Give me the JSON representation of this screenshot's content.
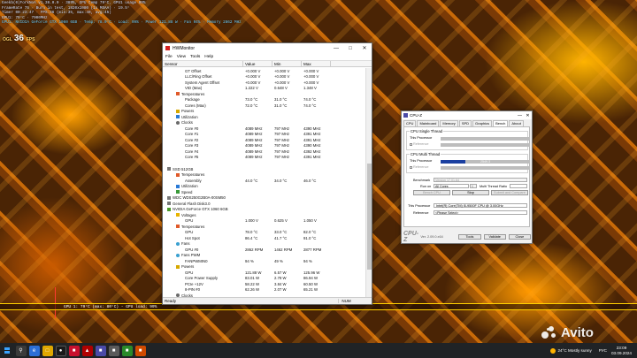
{
  "osd": {
    "lines": [
      "Geekb(0)ForkNoA v1.36.0.0 · 389%, GPU temp 79°C, GPU1 usage 99%",
      "FrameRate 75 · Burn in test, 1920x1080 (1x MSAA) · 19.5°",
      "Timer 00:23:47 · FPS:36 (min:35, max:40, avg:45)",
      "GPU1: 79°C · 7900MHz",
      "GPU1: NVIDIA GeForce GTX 1060 6GB · Temp: 78.0°C · Load: 99% · Power 121.88 W · Fan 94% · Memory 2862 MHz"
    ],
    "fps_label": "OGL",
    "fps_value": "36",
    "fps_unit": "FPS"
  },
  "bottom_overlay": "GPU 1: 79°C (max: 80°C) - GPU load: 99%",
  "hwmonitor": {
    "title": "HWMonitor",
    "menu": [
      "File",
      "View",
      "Tools",
      "Help"
    ],
    "columns": [
      "Sensor",
      "Value",
      "Min",
      "Max"
    ],
    "status_left": "Ready",
    "status_num": "NUM",
    "rows": [
      {
        "indent": 5,
        "icon": "none",
        "name": "GT Offset",
        "value": "+0.000 V",
        "min": "+0.000 V",
        "max": "+0.000 V"
      },
      {
        "indent": 5,
        "icon": "none",
        "name": "LLC/Ring Offset",
        "value": "+0.000 V",
        "min": "+0.000 V",
        "max": "+0.000 V"
      },
      {
        "indent": 5,
        "icon": "none",
        "name": "System Agent Offset",
        "value": "+0.000 V",
        "min": "+0.000 V",
        "max": "+0.000 V"
      },
      {
        "indent": 5,
        "icon": "none",
        "name": "VID (Max)",
        "value": "1.222 V",
        "min": "0.648 V",
        "max": "1.348 V"
      },
      {
        "indent": 3,
        "icon": "temp",
        "name": "Temperatures",
        "value": "",
        "min": "",
        "max": ""
      },
      {
        "indent": 5,
        "icon": "none",
        "name": "Package",
        "value": "73.0 °C",
        "min": "31.0 °C",
        "max": "74.0 °C"
      },
      {
        "indent": 5,
        "icon": "none",
        "name": "Cores (Max)",
        "value": "72.0 °C",
        "min": "31.0 °C",
        "max": "74.0 °C"
      },
      {
        "indent": 3,
        "icon": "power",
        "name": "Powers",
        "value": "",
        "min": "",
        "max": ""
      },
      {
        "indent": 3,
        "icon": "util",
        "name": "Utilization",
        "value": "",
        "min": "",
        "max": ""
      },
      {
        "indent": 3,
        "icon": "clock",
        "name": "Clocks",
        "value": "",
        "min": "",
        "max": ""
      },
      {
        "indent": 5,
        "icon": "none",
        "name": "Core #0",
        "value": "4089 MHz",
        "min": "797 MHz",
        "max": "4390 MHz"
      },
      {
        "indent": 5,
        "icon": "none",
        "name": "Core #1",
        "value": "4089 MHz",
        "min": "797 MHz",
        "max": "4391 MHz"
      },
      {
        "indent": 5,
        "icon": "none",
        "name": "Core #2",
        "value": "4089 MHz",
        "min": "797 MHz",
        "max": "4391 MHz"
      },
      {
        "indent": 5,
        "icon": "none",
        "name": "Core #3",
        "value": "4089 MHz",
        "min": "797 MHz",
        "max": "4390 MHz"
      },
      {
        "indent": 5,
        "icon": "none",
        "name": "Core #4",
        "value": "4089 MHz",
        "min": "797 MHz",
        "max": "4392 MHz"
      },
      {
        "indent": 5,
        "icon": "none",
        "name": "Core #5",
        "value": "4089 MHz",
        "min": "797 MHz",
        "max": "4391 MHz"
      },
      {
        "indent": 0,
        "icon": "none",
        "name": "",
        "value": "",
        "min": "",
        "max": ""
      },
      {
        "indent": 1,
        "icon": "disk",
        "name": "SSD 512GB",
        "value": "",
        "min": "",
        "max": ""
      },
      {
        "indent": 3,
        "icon": "temp",
        "name": "Temperatures",
        "value": "",
        "min": "",
        "max": ""
      },
      {
        "indent": 5,
        "icon": "none",
        "name": "Assembly",
        "value": "44.0 °C",
        "min": "34.0 °C",
        "max": "46.0 °C"
      },
      {
        "indent": 3,
        "icon": "util",
        "name": "Utilization",
        "value": "",
        "min": "",
        "max": ""
      },
      {
        "indent": 3,
        "icon": "speed",
        "name": "Speed",
        "value": "",
        "min": "",
        "max": ""
      },
      {
        "indent": 1,
        "icon": "disk",
        "name": "WDC WDS250G2B0A-00SM50",
        "value": "",
        "min": "",
        "max": ""
      },
      {
        "indent": 1,
        "icon": "disk",
        "name": "General Flash Disk3.0",
        "value": "",
        "min": "",
        "max": ""
      },
      {
        "indent": 1,
        "icon": "gpu",
        "name": "NVIDIA GeForce GTX 1060 6GB",
        "value": "",
        "min": "",
        "max": ""
      },
      {
        "indent": 3,
        "icon": "volt",
        "name": "Voltages",
        "value": "",
        "min": "",
        "max": ""
      },
      {
        "indent": 5,
        "icon": "none",
        "name": "GPU",
        "value": "1.000 V",
        "min": "0.625 V",
        "max": "1.050 V"
      },
      {
        "indent": 3,
        "icon": "temp",
        "name": "Temperatures",
        "value": "",
        "min": "",
        "max": ""
      },
      {
        "indent": 5,
        "icon": "none",
        "name": "GPU",
        "value": "78.0 °C",
        "min": "33.0 °C",
        "max": "82.0 °C"
      },
      {
        "indent": 5,
        "icon": "none",
        "name": "Hot Spot",
        "value": "86.4 °C",
        "min": "41.7 °C",
        "max": "91.0 °C"
      },
      {
        "indent": 3,
        "icon": "fan",
        "name": "Fans",
        "value": "",
        "min": "",
        "max": ""
      },
      {
        "indent": 5,
        "icon": "none",
        "name": "GPU #0",
        "value": "2862 RPM",
        "min": "1462 RPM",
        "max": "2877 RPM"
      },
      {
        "indent": 3,
        "icon": "fan",
        "name": "Fans PWM",
        "value": "",
        "min": "",
        "max": ""
      },
      {
        "indent": 5,
        "icon": "none",
        "name": "FANPWMIN0",
        "value": "94 %",
        "min": "49 %",
        "max": "94 %"
      },
      {
        "indent": 3,
        "icon": "power",
        "name": "Powers",
        "value": "",
        "min": "",
        "max": ""
      },
      {
        "indent": 5,
        "icon": "none",
        "name": "GPU",
        "value": "121.88 W",
        "min": "6.57 W",
        "max": "125.96 W"
      },
      {
        "indent": 5,
        "icon": "none",
        "name": "Core Power Supply",
        "value": "83.01 W",
        "min": "2.78 W",
        "max": "86.94 W"
      },
      {
        "indent": 5,
        "icon": "none",
        "name": "PCIe +12V",
        "value": "58.22 W",
        "min": "3.84 W",
        "max": "60.50 W"
      },
      {
        "indent": 5,
        "icon": "none",
        "name": "8-PIN #0",
        "value": "62.26 W",
        "min": "2.07 W",
        "max": "65.21 W"
      },
      {
        "indent": 3,
        "icon": "clock",
        "name": "Clocks",
        "value": "",
        "min": "",
        "max": ""
      }
    ]
  },
  "cpuz": {
    "title": "CPU-Z",
    "tabs": [
      "CPU",
      "Mainboard",
      "Memory",
      "SPD",
      "Graphics",
      "Bench",
      "About"
    ],
    "active_tab": "Bench",
    "single_thread_group": "CPU Single Thread",
    "multi_thread_group": "CPU Multi Thread",
    "this_processor_label": "This Processor",
    "reference_label": "Reference",
    "multi_score": "2549.3",
    "multi_score_fraction": 0.28,
    "benchmark_label": "Benchmark",
    "benchmark_value": "Version 17.01.64",
    "run_on_label": "Run on",
    "run_on_value": "All Cores",
    "threads_value": "6",
    "multi_ratio_label": "Multi Thread Ratio",
    "bench_cpu_button": "Bench CPU",
    "stop_button": "Stop",
    "submit_button": "Submit and Compare",
    "processor_label": "This Processor",
    "processor_value": "Intel(R) Core(TM) i5-9500F CPU @ 3.00GHz",
    "reference_select_label": "Reference",
    "reference_select_value": "<Please Select>",
    "brand": "CPU-Z",
    "version": "Ver. 2.09.0.x64",
    "tools_button": "Tools",
    "validate_button": "Validate",
    "close_button": "Close"
  },
  "taskbar": {
    "weather": "24°C  Mostly sunny",
    "lang": "РУС",
    "time": "23:09",
    "date": "03.09.2024"
  },
  "watermark": "Avito"
}
